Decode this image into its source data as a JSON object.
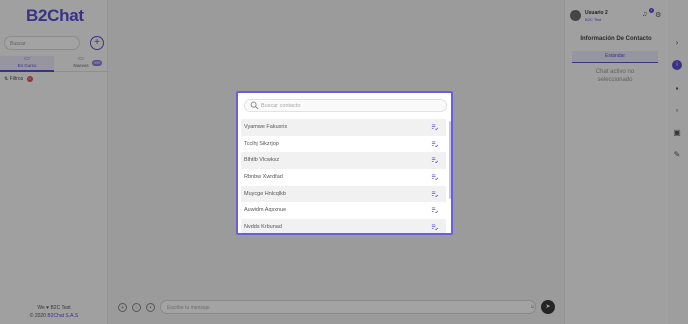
{
  "app": {
    "logo": "B2Chat"
  },
  "left_panel": {
    "search_placeholder": "Buscar",
    "add_symbol": "+",
    "tabs": [
      {
        "label": "En Curso"
      },
      {
        "label": "Nuevos",
        "badge": "999"
      }
    ],
    "filters_label": "Filtros",
    "filters_count": "0",
    "footer_line1": "We ♥ B2C Test",
    "footer_line2_prefix": "© 2020",
    "footer_line2_brand": "B2Chat S.A.S"
  },
  "composer": {
    "placeholder": "Escribe tu mensaje"
  },
  "header_user": {
    "name": "Usuario 2",
    "org": "B2C Test",
    "notif_count": "1"
  },
  "contact_info": {
    "title": "Información De Contacto",
    "tab": "Estándar",
    "empty_line1": "Chat activo no",
    "empty_line2": "seleccionado"
  },
  "modal": {
    "search_placeholder": "Buscar contacto",
    "contacts": [
      {
        "name": "Vyamwe Fakuxrix"
      },
      {
        "name": "Tcclhj Sikzrjop"
      },
      {
        "name": "Blhtlb Vlcwkxz"
      },
      {
        "name": "Rbnbw Xwrdfad"
      },
      {
        "name": "Muycge Hnlcqlkb"
      },
      {
        "name": "Auwidm Aqsxnue"
      },
      {
        "name": "Nvdds Krbunad"
      }
    ]
  },
  "colors": {
    "accent": "#6a5ee0",
    "brand": "#5b4fd1",
    "overlay": "rgba(0,0,0,0.36)"
  },
  "icons": [
    "search-icon",
    "add-icon",
    "chat-icon",
    "filter-icon",
    "send-icon",
    "emoji-icon",
    "attach-icon",
    "bell-icon",
    "gear-icon",
    "logout-icon",
    "start-chat-icon"
  ]
}
